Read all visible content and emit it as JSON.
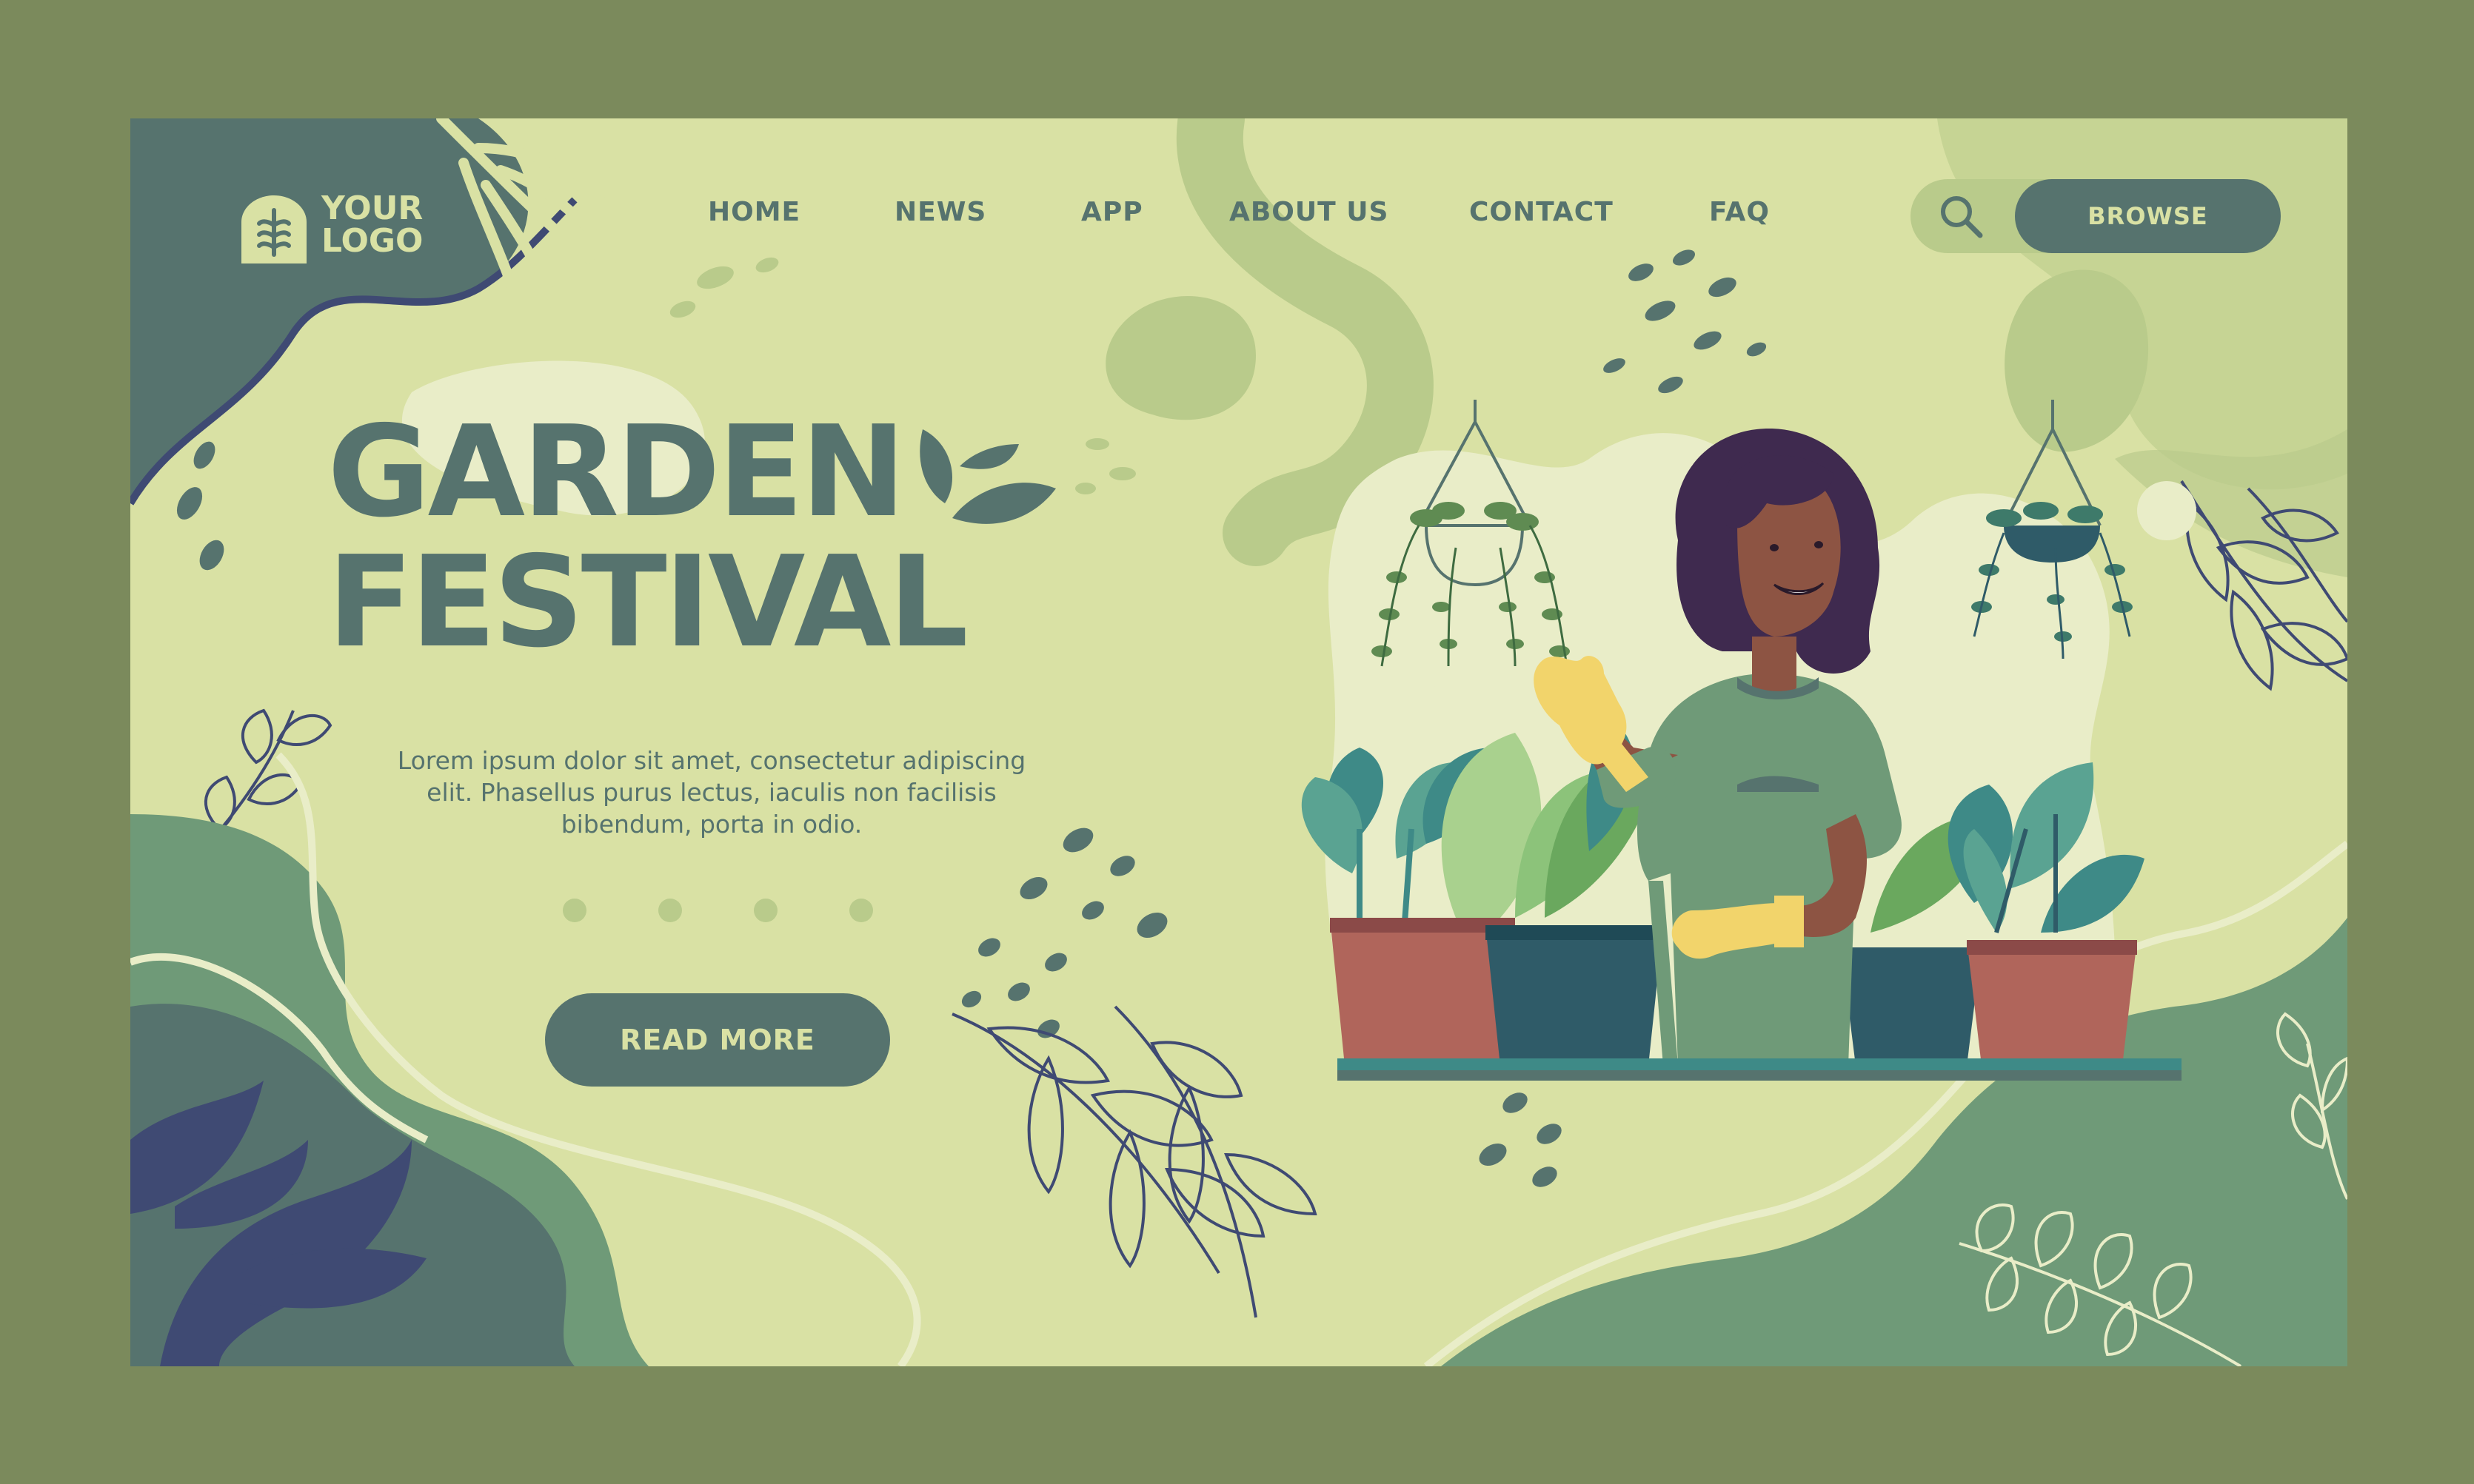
{
  "logo": {
    "line1": "YOUR",
    "line2": "LOGO"
  },
  "nav": {
    "items": [
      {
        "label": "HOME"
      },
      {
        "label": "NEWS"
      },
      {
        "label": "APP"
      },
      {
        "label": "ABOUT US"
      },
      {
        "label": "CONTACT"
      },
      {
        "label": "FAQ"
      }
    ]
  },
  "search": {
    "icon": "search-icon"
  },
  "browse": {
    "label": "BROWSE"
  },
  "hero": {
    "title_line1": "GARDEN",
    "title_line2": "FESTIVAL",
    "description": "Lorem ipsum dolor sit amet, consectetur adipiscing elit. Phasellus purus lectus, iaculis non facilisis bibendum, porta in odio."
  },
  "carousel": {
    "dots": 4
  },
  "cta": {
    "label": "READ MORE"
  },
  "colors": {
    "background": "#d9e1a4",
    "outer": "#7b8a5c",
    "primary": "#56736e",
    "light_green": "#b9cb8b",
    "mid_green": "#6f9a78",
    "navy": "#3f4a73",
    "skin": "#8d5443",
    "hair": "#3f2a4f",
    "glove": "#f2d46b",
    "pot_terracotta": "#b0655b",
    "pot_blue": "#2f5b68"
  }
}
